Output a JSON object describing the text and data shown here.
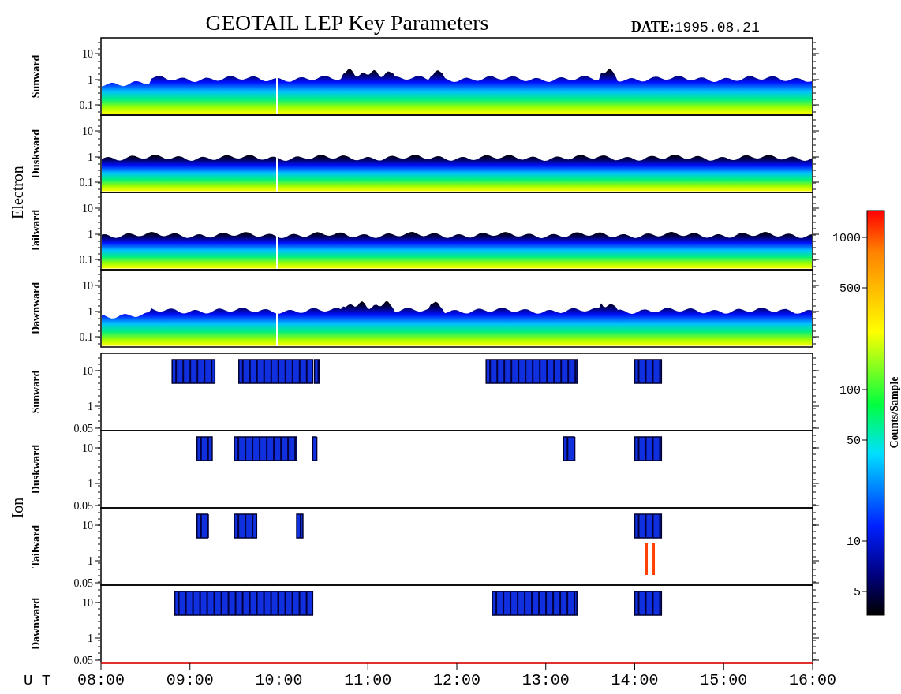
{
  "title": "GEOTAIL LEP Key Parameters",
  "date_label": "DATE:",
  "date": "1995.08.21",
  "groups": [
    {
      "label": "Electron",
      "panels": [
        {
          "label": "Sunward",
          "yticks": [
            "10",
            "1",
            "0.1"
          ]
        },
        {
          "label": "Duskward",
          "yticks": [
            "10",
            "1",
            "0.1"
          ]
        },
        {
          "label": "Tailward",
          "yticks": [
            "10",
            "1",
            "0.1"
          ]
        },
        {
          "label": "Dawnward",
          "yticks": [
            "10",
            "1",
            "0.1"
          ]
        }
      ]
    },
    {
      "label": "Ion",
      "panels": [
        {
          "label": "Sunward",
          "yticks": [
            "10",
            "1",
            "0.05"
          ]
        },
        {
          "label": "Duskward",
          "yticks": [
            "10",
            "1",
            "0.05"
          ]
        },
        {
          "label": "Tailward",
          "yticks": [
            "10",
            "1",
            "0.05"
          ]
        },
        {
          "label": "Dawnward",
          "yticks": [
            "10",
            "1",
            "0.05"
          ]
        }
      ]
    }
  ],
  "x_axis": {
    "label": "U T",
    "ticks": [
      "08:00",
      "09:00",
      "10:00",
      "11:00",
      "12:00",
      "13:00",
      "14:00",
      "15:00",
      "16:00"
    ]
  },
  "colorbar": {
    "label": "Counts/Sample",
    "ticks": [
      "1000",
      "500",
      "100",
      "50",
      "10",
      "5"
    ]
  }
}
